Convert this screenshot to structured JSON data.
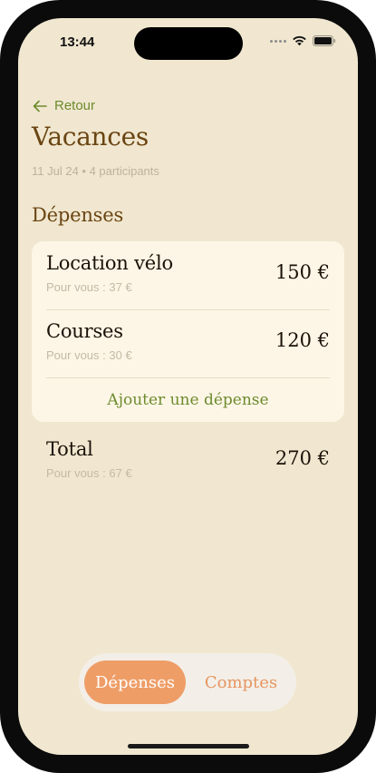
{
  "status_bar": {
    "time": "13:44"
  },
  "navigation": {
    "back_label": "Retour"
  },
  "trip": {
    "title": "Vacances",
    "subtitle": "11 Jul 24 • 4 participants"
  },
  "expenses_section": {
    "title": "Dépenses",
    "items": [
      {
        "name": "Location vélo",
        "share": "Pour vous : 37 €",
        "amount": "150 €"
      },
      {
        "name": "Courses",
        "share": "Pour vous : 30 €",
        "amount": "120 €"
      }
    ],
    "add_label": "Ajouter une dépense"
  },
  "total": {
    "label": "Total",
    "share": "Pour vous : 67 €",
    "amount": "270 €"
  },
  "tabbar": {
    "tabs": [
      {
        "label": "Dépenses",
        "active": true
      },
      {
        "label": "Comptes",
        "active": false
      }
    ]
  },
  "colors": {
    "background": "#f1e7d0",
    "card": "#fdf6e6",
    "accent_green": "#6d8b2e",
    "title_brown": "#6a4512",
    "tab_orange": "#ef9d67"
  },
  "icons": {
    "back": "arrow-left-icon",
    "wifi": "wifi-icon",
    "battery": "battery-icon",
    "signal": "signal-dots-icon"
  }
}
